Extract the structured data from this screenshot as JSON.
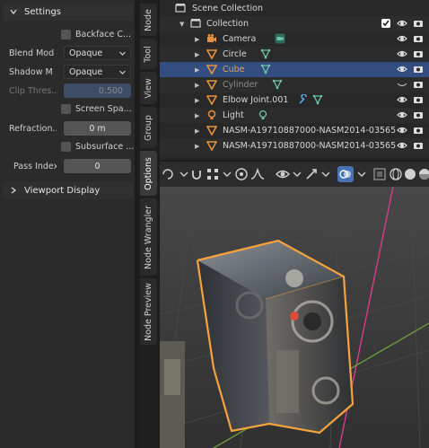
{
  "left_panel": {
    "settings_header": "Settings",
    "backface_culling": "Backface C...",
    "blend_mode_label": "Blend Mod",
    "blend_mode_value": "Opaque",
    "shadow_mode_label": "Shadow M",
    "shadow_mode_value": "Opaque",
    "clip_threshold_label": "Clip Thres...",
    "clip_threshold_value": "0.500",
    "screen_space_refraction": "Screen Spa...",
    "refraction_depth_label": "Refraction...",
    "refraction_depth_value": "0 m",
    "subsurface_translucency": "Subsurface ...",
    "pass_index_label": "Pass Index",
    "pass_index_value": "0",
    "viewport_display_header": "Viewport Display"
  },
  "tabs": [
    "Node",
    "Tool",
    "View",
    "Group",
    "Options",
    "Node Wrangler",
    "Node Preview"
  ],
  "active_tab": "Options",
  "outliner": {
    "scene_collection": "Scene Collection",
    "collection": "Collection",
    "items": [
      {
        "label": "Camera",
        "icon": "camera-icon",
        "color": "#e8913a"
      },
      {
        "label": "Circle",
        "icon": "mesh-icon",
        "color": "#e8913a"
      },
      {
        "label": "Cube",
        "icon": "mesh-icon",
        "color": "#e8913a"
      },
      {
        "label": "Cylinder",
        "icon": "mesh-icon",
        "color": "#e8913a"
      },
      {
        "label": "Elbow Joint.001",
        "icon": "mesh-icon",
        "color": "#e8913a"
      },
      {
        "label": "Light",
        "icon": "light-icon",
        "color": "#e8913a"
      },
      {
        "label": "NASM-A19710887000-NASM2014-03565",
        "icon": "mesh-icon",
        "color": "#e8913a"
      },
      {
        "label": "NASM-A19710887000-NASM2014-03565",
        "icon": "mesh-icon",
        "color": "#e8913a"
      }
    ]
  },
  "colors": {
    "accent_blue": "#4772b3",
    "selection_bg": "#334d80",
    "object_orange": "#e8913a",
    "data_green": "#6ec3a2",
    "outline_orange": "#f5a33d"
  }
}
